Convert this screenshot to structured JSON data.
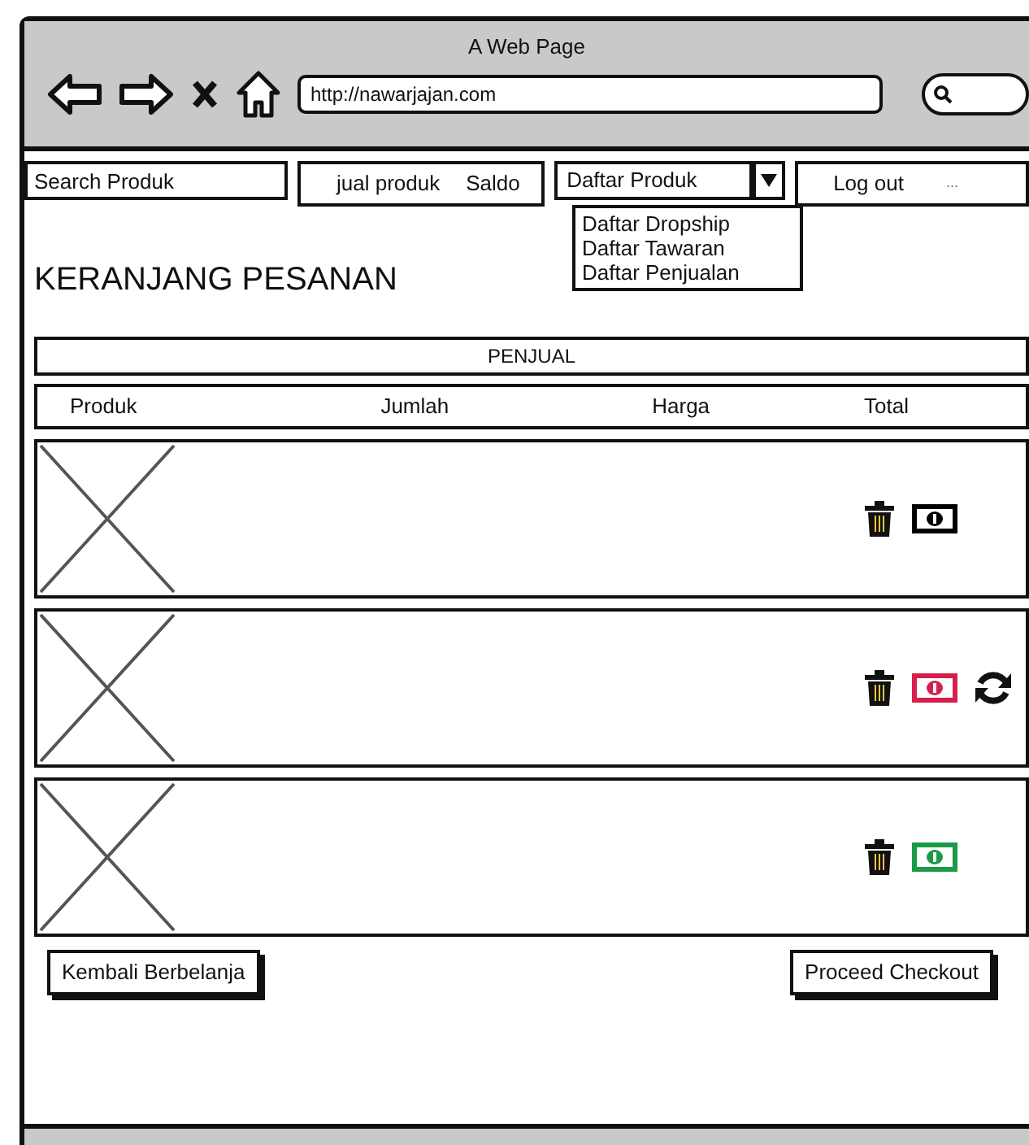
{
  "window": {
    "title": "A Web Page",
    "url": "http://nawarjajan.com"
  },
  "nav": {
    "search_placeholder": "Search Produk",
    "links": [
      "jual produk",
      "Saldo"
    ],
    "dropdown": {
      "label": "Daftar Produk",
      "expanded": true,
      "options": [
        "Daftar Dropship",
        "Daftar Tawaran",
        "Daftar Penjualan"
      ]
    },
    "logout": "Log out",
    "more": "..."
  },
  "heading": "KERANJANG PESANAN",
  "seller_bar": "PENJUAL",
  "columns": [
    "Produk",
    "Jumlah",
    "Harga",
    "Total"
  ],
  "items": [
    {
      "color": "#000000",
      "refresh": false
    },
    {
      "color": "#d6204b",
      "refresh": true
    },
    {
      "color": "#1a9a4a",
      "refresh": false
    }
  ],
  "buttons": [
    "Kembali Berbelanja",
    "Proceed Checkout"
  ]
}
